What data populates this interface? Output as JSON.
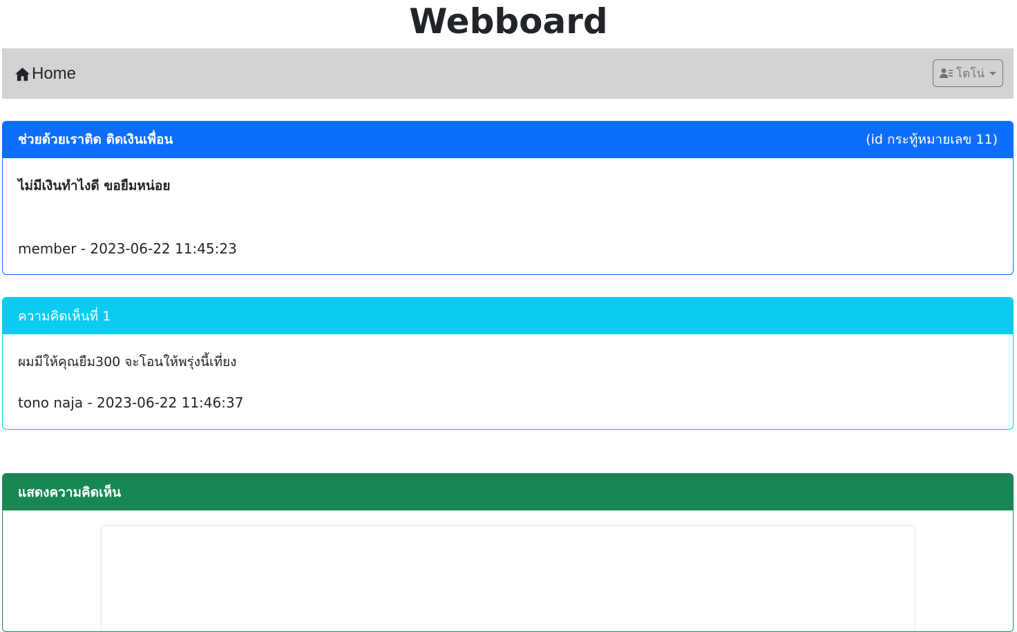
{
  "header": {
    "title": "Webboard"
  },
  "navbar": {
    "home_label": "Home",
    "home_icon": "house-icon",
    "user_icon": "user-list-icon",
    "user_name": "โตโน่"
  },
  "topic": {
    "title": "ช่วยด้วยเราติด ติดเงินเพื่อน",
    "id_text": "(id กระทู้หมายเลข 11)",
    "body": "ไม่มีเงินทำไงดี ขอยืมหน่อย",
    "meta": "member - 2023-06-22 11:45:23",
    "color": "#0d6efd"
  },
  "comments": [
    {
      "title": "ความคิดเห็นที่ 1",
      "body": "ผมมีให้คุณยืม300 จะโอนให้พรุ่งนี้เที่ยง",
      "meta": "tono naja - 2023-06-22 11:46:37",
      "color": "#0dcaf0"
    }
  ],
  "reply": {
    "title": "แสดงความคิดเห็น",
    "textarea_value": "",
    "color": "#198754"
  }
}
